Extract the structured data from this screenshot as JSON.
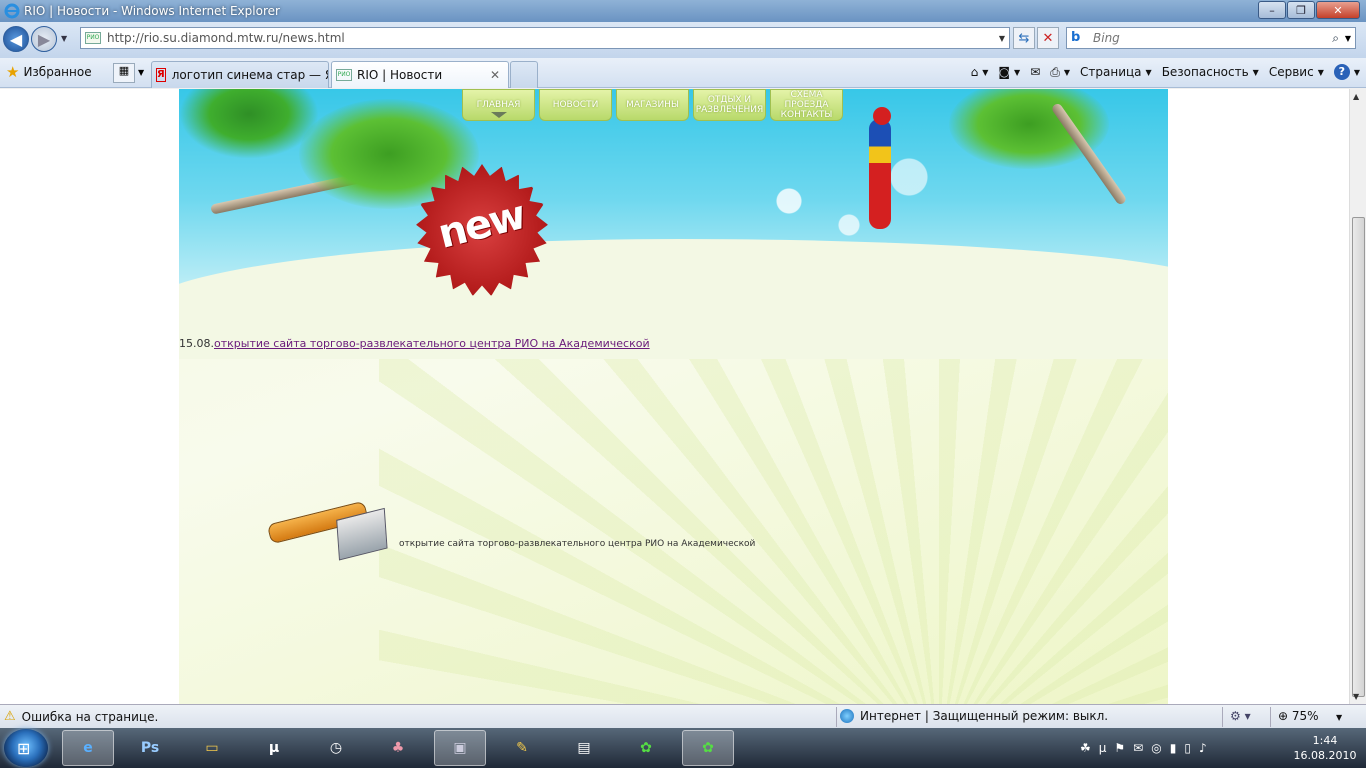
{
  "window": {
    "title": "RIO | Новости - Windows Internet Explorer"
  },
  "address": {
    "url": "http://rio.su.diamond.mtw.ru/news.html",
    "search_placeholder": "Bing"
  },
  "favorites": {
    "label": "Избранное"
  },
  "tabs": [
    {
      "label": "логотип синема стар — Я..."
    },
    {
      "label": "RIO | Новости"
    }
  ],
  "command_bar": {
    "page": "Страница",
    "safety": "Безопасность",
    "tools": "Сервис"
  },
  "site": {
    "nav": [
      {
        "label": "ГЛАВНАЯ"
      },
      {
        "label": "НОВОСТИ"
      },
      {
        "label": "МАГАЗИНЫ"
      },
      {
        "label": "ОТДЫХ И\nРАЗВЛЕЧЕНИЯ"
      },
      {
        "label": "СХЕМА\nПРОЕЗДА\nКОНТАКТЫ"
      }
    ],
    "badge": "new",
    "news": {
      "date": "15.08.",
      "link": "открытие сайта торгово-развлекательного центра РИО на Академической"
    },
    "product_caption": "открытие сайта торгово-развлекательного центра  РИО на Академической"
  },
  "status": {
    "error": "Ошибка на странице.",
    "zone": "Интернет | Защищенный режим: выкл.",
    "zoom": "75%"
  },
  "taskbar": {
    "time": "1:44",
    "date": "16.08.2010"
  }
}
